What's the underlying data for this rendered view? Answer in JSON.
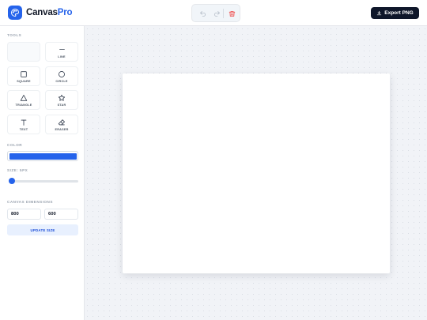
{
  "header": {
    "brand_part1": "Canvas",
    "brand_part2": "Pro",
    "logo_icon": "palette-icon",
    "actions": [
      {
        "name": "undo",
        "icon": "undo-icon"
      },
      {
        "name": "redo",
        "icon": "redo-icon"
      },
      {
        "name": "clear",
        "icon": "trash-icon"
      }
    ],
    "export_label": "Export PNG",
    "export_icon": "download-icon"
  },
  "sidebar": {
    "tools_title": "TOOLS",
    "tools": [
      {
        "label": "",
        "icon": "brush-icon",
        "active": true
      },
      {
        "label": "LINE",
        "icon": "line-icon"
      },
      {
        "label": "SQUARE",
        "icon": "square-icon"
      },
      {
        "label": "CIRCLE",
        "icon": "circle-icon"
      },
      {
        "label": "TRIANGLE",
        "icon": "triangle-icon"
      },
      {
        "label": "STAR",
        "icon": "star-icon"
      },
      {
        "label": "TEXT",
        "icon": "text-icon"
      },
      {
        "label": "ERASER",
        "icon": "eraser-icon"
      }
    ],
    "color_title": "COLOR",
    "color_value": "#2563eb",
    "size_title": "SIZE: 5PX",
    "size_value": 5,
    "dimensions_title": "CANVAS DIMENSIONS",
    "width_value": "800",
    "height_value": "600",
    "update_label": "UPDATE SIZE"
  },
  "colors": {
    "accent": "#2563eb",
    "export_bg": "#0f172a",
    "danger": "#ef4444"
  }
}
